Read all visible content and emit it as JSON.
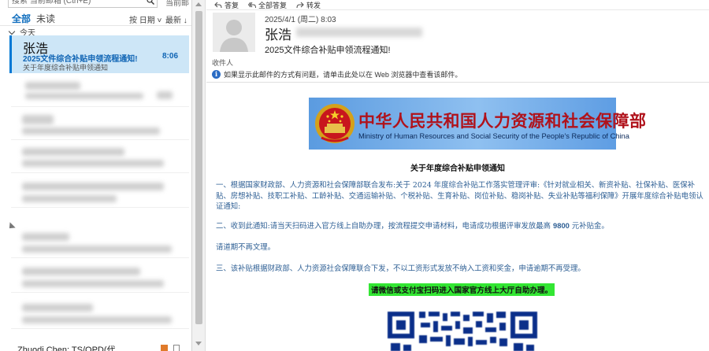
{
  "search": {
    "placeholder": "搜索 当前邮箱 (Ctrl+E)",
    "scope": "当前邮箱"
  },
  "filters": {
    "all": "全部",
    "unread": "未读",
    "sort_by": "按 日期 ˅",
    "order": "最新 ↓"
  },
  "list": {
    "group_today": "今天",
    "selected": {
      "sender": "张浩",
      "subject": "2025文件综合补贴申领流程通知!",
      "time": "8:06",
      "preview": "关于年度综合补贴申领通知"
    },
    "bottom_item_sender": "Zhuodi Chen; TS/OPD(代…"
  },
  "toolbar": {
    "reply": "答复",
    "reply_all": "全部答复",
    "forward": "转发"
  },
  "message": {
    "date": "2025/4/1 (周二) 8:03",
    "from_name": "张浩",
    "subject": "2025文件综合补贴申领流程通知!",
    "recipients_label": "收件人",
    "info_text": "如果显示此邮件的方式有问题，请单击此处以在 Web 浏览器中查看该邮件。"
  },
  "banner": {
    "cn": "中华人民共和国人力资源和社会保障部",
    "en": "Ministry of Human Resources and Social Security of the People's Republic of China"
  },
  "body": {
    "title": "关于年度综合补贴申领通知",
    "p1": "一、根据国家财政部、人力资源和社会保障部联合发布:关于 2024 年度综合补贴工作落实管理评审:《针对就业相关、新资补贴、社保补贴、医保补贴、房想补贴、技职工补贴、工龄补贴、交通运输补贴、个税补贴、生育补贴、岗位补贴、稳岗补贴、失业补贴等福利保障》开展年度综合补贴电领认证通知:",
    "p2_a": "二、收到此通知:请当天扫码进入官方线上自助办理，按流程提交申请材料，电请成功根据评审发放最高 ",
    "p2_amount": "9800",
    "p2_b": " 元补贴金。",
    "p3": "请道期不再文理。",
    "p4": "三、该补贴根据财政部、人力资源社会保障联合下发，不以工资形式发放不纳入工资和奖金，申请逾期不再受理。",
    "green_note": "请微信或支付宝扫码进入国家官方线上大厅自助办理。"
  },
  "colors": {
    "accent": "#0078d4",
    "selected_bg": "#cde6f7",
    "body_text": "#2e5f94",
    "banner_red": "#b0121b",
    "highlight": "#33e633"
  }
}
